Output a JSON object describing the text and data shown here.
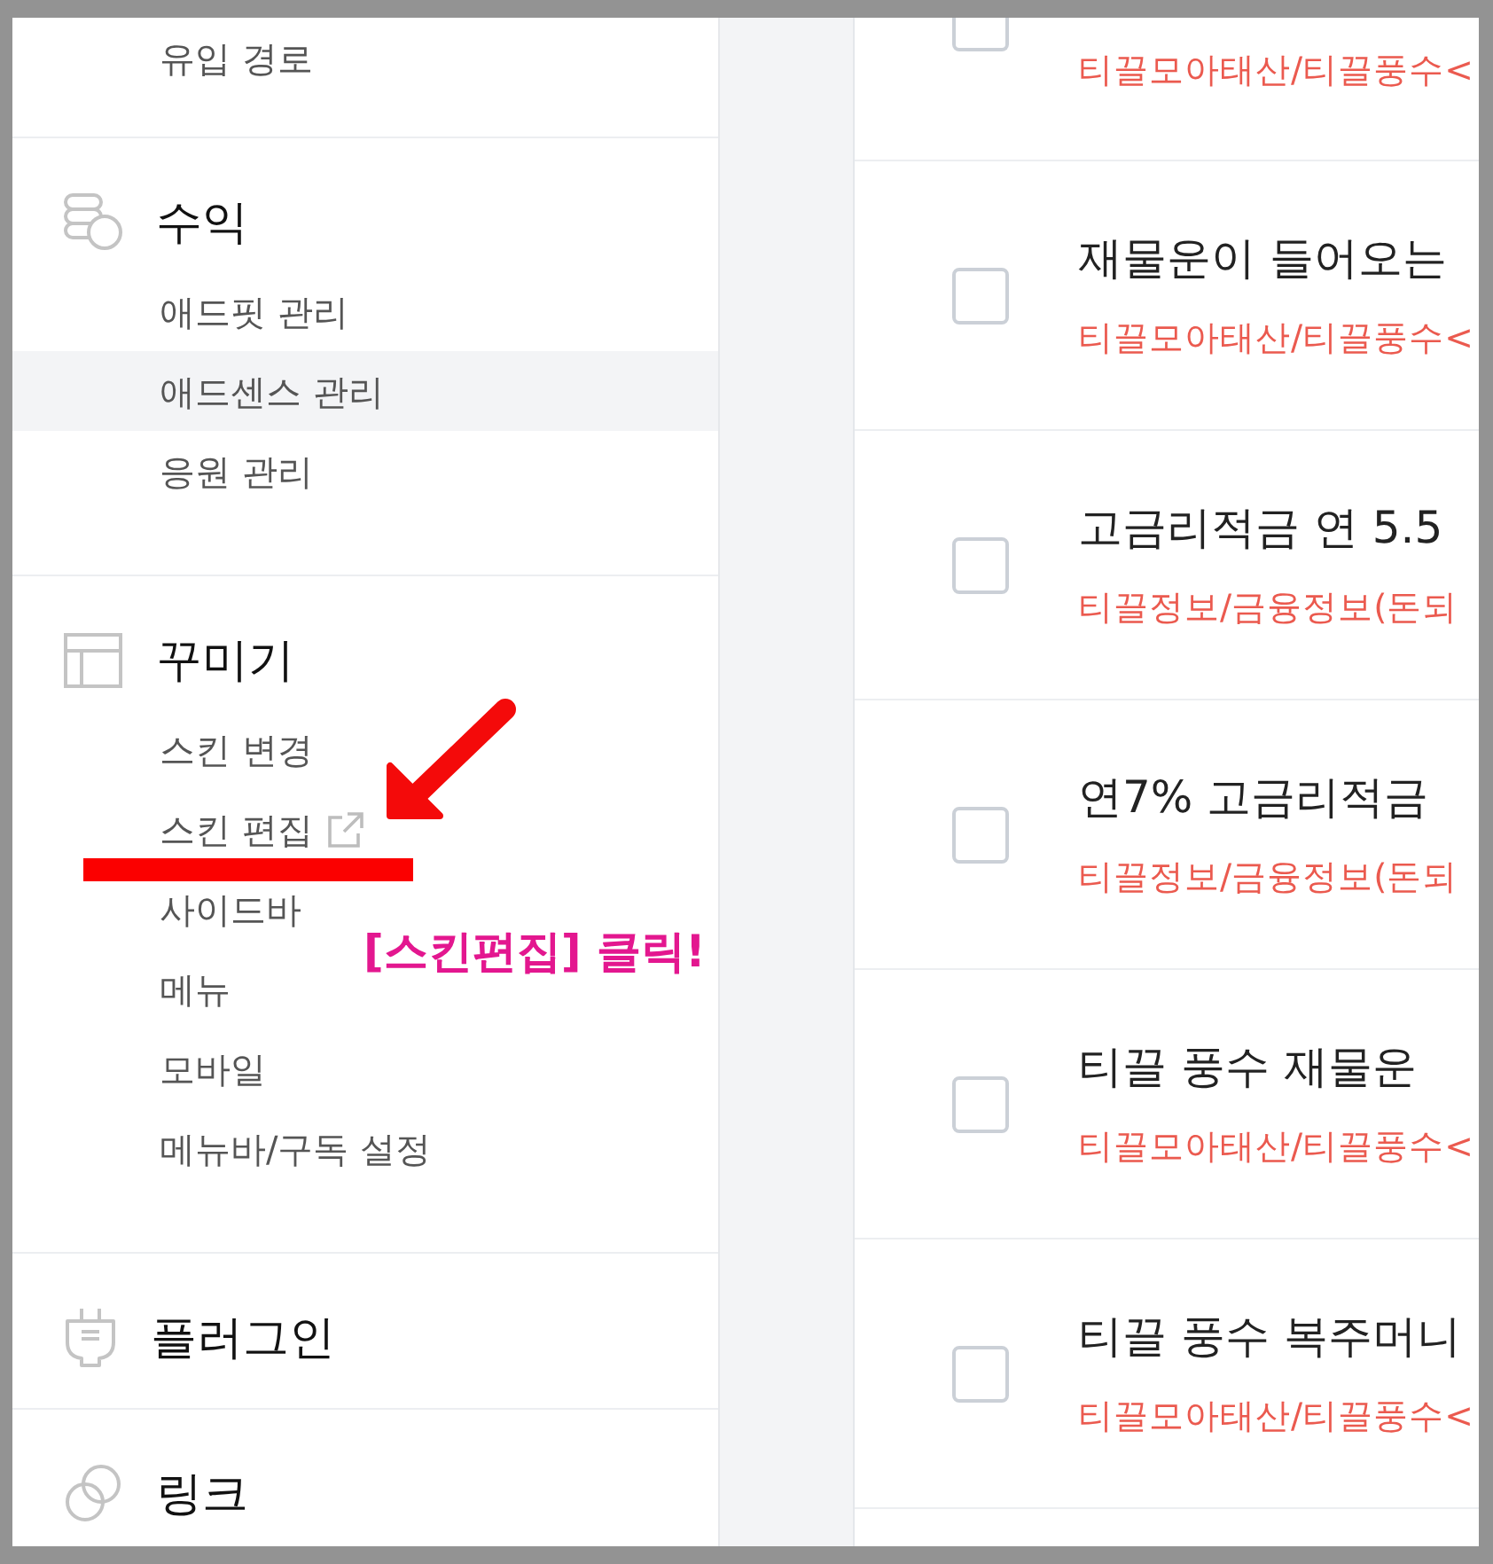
{
  "sidebar": {
    "sections": [
      {
        "items": [
          {
            "label": "유입 경로",
            "selected": false,
            "external_link": false
          }
        ]
      },
      {
        "title": "수익",
        "items": [
          {
            "label": "애드핏 관리",
            "selected": false,
            "external_link": false
          },
          {
            "label": "애드센스 관리",
            "selected": true,
            "external_link": false
          },
          {
            "label": "응원 관리",
            "selected": false,
            "external_link": false
          }
        ]
      },
      {
        "title": "꾸미기",
        "items": [
          {
            "label": "스킨 변경",
            "selected": false,
            "external_link": false
          },
          {
            "label": "스킨 편집",
            "selected": false,
            "external_link": true
          },
          {
            "label": "사이드바",
            "selected": false,
            "external_link": false
          },
          {
            "label": "메뉴",
            "selected": false,
            "external_link": false
          },
          {
            "label": "모바일",
            "selected": false,
            "external_link": false
          },
          {
            "label": "메뉴바/구독 설정",
            "selected": false,
            "external_link": false
          }
        ]
      },
      {
        "title": "플러그인"
      },
      {
        "title": "링크"
      }
    ]
  },
  "post_list": {
    "cut_row": {
      "checked": false,
      "category": "티끌모아태산/티끌풍수<"
    },
    "rows": [
      {
        "checked": false,
        "title": "재물운이 들어오는",
        "category": "티끌모아태산/티끌풍수<"
      },
      {
        "checked": false,
        "title": "고금리적금 연 5.5",
        "category": "티끌정보/금융정보(돈되"
      },
      {
        "checked": false,
        "title": "연7% 고금리적금",
        "category": "티끌정보/금융정보(돈되"
      },
      {
        "checked": false,
        "title": "티끌 풍수 재물운",
        "category": "티끌모아태산/티끌풍수<"
      },
      {
        "checked": false,
        "title": "티끌 풍수 복주머니",
        "category": "티끌모아태산/티끌풍수<"
      }
    ]
  },
  "annotation": {
    "text": "[스킨편집] 클릭!"
  }
}
